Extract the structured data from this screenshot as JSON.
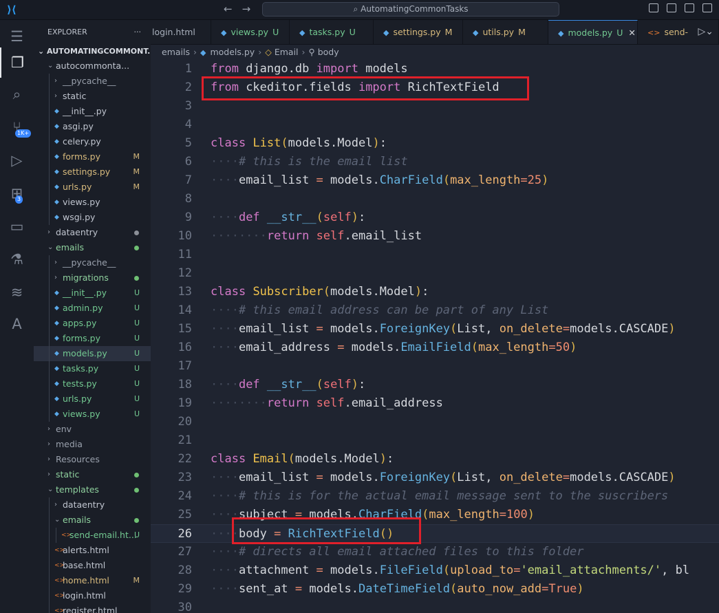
{
  "titlebar": {
    "search_text": "AutomatingCommonTasks"
  },
  "explorer": {
    "header": "EXPLORER",
    "root": "AUTOMATINGCOMMONT...",
    "items": [
      {
        "label": "autocommonta...",
        "depth": 1,
        "kind": "folder",
        "open": true,
        "status": "",
        "statusColor": "#8b8f97"
      },
      {
        "label": "__pycache__",
        "depth": 2,
        "kind": "folder",
        "open": false,
        "status": "",
        "statusColor": "",
        "color": "#9aa1ad"
      },
      {
        "label": "static",
        "depth": 2,
        "kind": "folder",
        "open": false,
        "status": "",
        "statusColor": ""
      },
      {
        "label": "__init__.py",
        "depth": 2,
        "kind": "file",
        "status": "",
        "statusColor": ""
      },
      {
        "label": "asgi.py",
        "depth": 2,
        "kind": "file",
        "status": "",
        "statusColor": ""
      },
      {
        "label": "celery.py",
        "depth": 2,
        "kind": "file",
        "status": "",
        "statusColor": ""
      },
      {
        "label": "forms.py",
        "depth": 2,
        "kind": "file",
        "status": "M",
        "statusColor": "#d7ba7d",
        "color": "#d7ba7d"
      },
      {
        "label": "settings.py",
        "depth": 2,
        "kind": "file",
        "status": "M",
        "statusColor": "#d7ba7d",
        "color": "#d7ba7d"
      },
      {
        "label": "urls.py",
        "depth": 2,
        "kind": "file",
        "status": "M",
        "statusColor": "#d7ba7d",
        "color": "#d7ba7d"
      },
      {
        "label": "views.py",
        "depth": 2,
        "kind": "file",
        "status": "",
        "statusColor": ""
      },
      {
        "label": "wsgi.py",
        "depth": 2,
        "kind": "file",
        "status": "",
        "statusColor": ""
      },
      {
        "label": "dataentry",
        "depth": 1,
        "kind": "folder",
        "open": false,
        "status": "dot",
        "statusColor": "#8b8f97"
      },
      {
        "label": "emails",
        "depth": 1,
        "kind": "folder",
        "open": true,
        "status": "dot",
        "statusColor": "#6fbf73",
        "color": "#8fd19e"
      },
      {
        "label": "__pycache__",
        "depth": 2,
        "kind": "folder",
        "open": false,
        "status": "",
        "statusColor": "",
        "color": "#9aa1ad"
      },
      {
        "label": "migrations",
        "depth": 2,
        "kind": "folder",
        "open": false,
        "status": "dot",
        "statusColor": "#6fbf73",
        "color": "#8fd19e"
      },
      {
        "label": "__init__.py",
        "depth": 2,
        "kind": "file",
        "status": "U",
        "statusColor": "#73c991",
        "color": "#73c991"
      },
      {
        "label": "admin.py",
        "depth": 2,
        "kind": "file",
        "status": "U",
        "statusColor": "#73c991",
        "color": "#73c991"
      },
      {
        "label": "apps.py",
        "depth": 2,
        "kind": "file",
        "status": "U",
        "statusColor": "#73c991",
        "color": "#73c991"
      },
      {
        "label": "forms.py",
        "depth": 2,
        "kind": "file",
        "status": "U",
        "statusColor": "#73c991",
        "color": "#73c991"
      },
      {
        "label": "models.py",
        "depth": 2,
        "kind": "file",
        "status": "U",
        "statusColor": "#73c991",
        "color": "#73c991",
        "selected": true
      },
      {
        "label": "tasks.py",
        "depth": 2,
        "kind": "file",
        "status": "U",
        "statusColor": "#73c991",
        "color": "#73c991"
      },
      {
        "label": "tests.py",
        "depth": 2,
        "kind": "file",
        "status": "U",
        "statusColor": "#73c991",
        "color": "#73c991"
      },
      {
        "label": "urls.py",
        "depth": 2,
        "kind": "file",
        "status": "U",
        "statusColor": "#73c991",
        "color": "#73c991"
      },
      {
        "label": "views.py",
        "depth": 2,
        "kind": "file",
        "status": "U",
        "statusColor": "#73c991",
        "color": "#73c991"
      },
      {
        "label": "env",
        "depth": 1,
        "kind": "folder",
        "open": false,
        "status": "",
        "statusColor": "",
        "color": "#9aa1ad"
      },
      {
        "label": "media",
        "depth": 1,
        "kind": "folder",
        "open": false,
        "status": "",
        "statusColor": "",
        "color": "#9aa1ad"
      },
      {
        "label": "Resources",
        "depth": 1,
        "kind": "folder",
        "open": false,
        "status": "",
        "statusColor": "",
        "color": "#9aa1ad"
      },
      {
        "label": "static",
        "depth": 1,
        "kind": "folder",
        "open": false,
        "status": "dot",
        "statusColor": "#6fbf73",
        "color": "#8fd19e"
      },
      {
        "label": "templates",
        "depth": 1,
        "kind": "folder",
        "open": true,
        "status": "dot",
        "statusColor": "#6fbf73",
        "color": "#8fd19e"
      },
      {
        "label": "dataentry",
        "depth": 2,
        "kind": "folder",
        "open": false,
        "status": "",
        "statusColor": ""
      },
      {
        "label": "emails",
        "depth": 2,
        "kind": "folder",
        "open": true,
        "status": "dot",
        "statusColor": "#6fbf73",
        "color": "#8fd19e"
      },
      {
        "label": "send-email.ht...",
        "depth": 3,
        "kind": "html",
        "status": "U",
        "statusColor": "#73c991",
        "color": "#73c991"
      },
      {
        "label": "alerts.html",
        "depth": 2,
        "kind": "html",
        "status": "",
        "statusColor": ""
      },
      {
        "label": "base.html",
        "depth": 2,
        "kind": "html",
        "status": "",
        "statusColor": ""
      },
      {
        "label": "home.html",
        "depth": 2,
        "kind": "html",
        "status": "M",
        "statusColor": "#d7ba7d",
        "color": "#d7ba7d"
      },
      {
        "label": "login.html",
        "depth": 2,
        "kind": "html",
        "status": "",
        "statusColor": ""
      },
      {
        "label": "register.html",
        "depth": 2,
        "kind": "html",
        "status": "",
        "statusColor": ""
      }
    ]
  },
  "activity_badges": {
    "source_control": "1K+",
    "extensions": "3"
  },
  "tabs": [
    {
      "label": "login.html",
      "kind": "html",
      "status": "",
      "statusColor": "",
      "color": "#a9b0bc"
    },
    {
      "label": "views.py",
      "kind": "py",
      "status": "U",
      "statusColor": "#73c991",
      "color": "#73c991"
    },
    {
      "label": "tasks.py",
      "kind": "py",
      "status": "U",
      "statusColor": "#73c991",
      "color": "#73c991"
    },
    {
      "label": "settings.py",
      "kind": "py",
      "status": "M",
      "statusColor": "#d7ba7d",
      "color": "#d7ba7d"
    },
    {
      "label": "utils.py",
      "kind": "py",
      "status": "M",
      "statusColor": "#d7ba7d",
      "color": "#d7ba7d"
    },
    {
      "label": "models.py",
      "kind": "py",
      "status": "U",
      "statusColor": "#73c991",
      "color": "#73c991",
      "active": true
    },
    {
      "label": "send-",
      "kind": "html",
      "status": "",
      "statusColor": "",
      "color": "#d7ba7d"
    }
  ],
  "breadcrumb": {
    "part1": "emails",
    "part2": "models.py",
    "part3": "Email",
    "part4": "body"
  },
  "editor": {
    "current_line": 26,
    "lines": [
      [
        [
          "kw",
          "from"
        ],
        [
          "id",
          " django.db "
        ],
        [
          "kw",
          "import"
        ],
        [
          "id",
          " models"
        ]
      ],
      [
        [
          "kw",
          "from"
        ],
        [
          "id",
          " ckeditor.fields "
        ],
        [
          "kw",
          "import"
        ],
        [
          "id",
          " RichTextField"
        ]
      ],
      [],
      [],
      [
        [
          "kw",
          "class"
        ],
        [
          "id",
          " "
        ],
        [
          "cls",
          "List"
        ],
        [
          "par",
          "("
        ],
        [
          "id",
          "models.Model"
        ],
        [
          "par",
          ")"
        ],
        [
          "id",
          ":"
        ]
      ],
      [
        [
          "ws",
          "····"
        ],
        [
          "cm",
          "# this is the email list"
        ]
      ],
      [
        [
          "ws",
          "····"
        ],
        [
          "id",
          "email_list "
        ],
        [
          "op",
          "="
        ],
        [
          "id",
          " models."
        ],
        [
          "fn",
          "CharField"
        ],
        [
          "par",
          "("
        ],
        [
          "arg",
          "max_length"
        ],
        [
          "op",
          "="
        ],
        [
          "num",
          "25"
        ],
        [
          "par",
          ")"
        ]
      ],
      [],
      [
        [
          "ws",
          "····"
        ],
        [
          "kw",
          "def"
        ],
        [
          "id",
          " "
        ],
        [
          "fn",
          "__str__"
        ],
        [
          "par",
          "("
        ],
        [
          "slf",
          "self"
        ],
        [
          "par",
          ")"
        ],
        [
          "id",
          ":"
        ]
      ],
      [
        [
          "ws",
          "········"
        ],
        [
          "kw",
          "return"
        ],
        [
          "id",
          " "
        ],
        [
          "slf",
          "self"
        ],
        [
          "id",
          ".email_list"
        ]
      ],
      [],
      [],
      [
        [
          "kw",
          "class"
        ],
        [
          "id",
          " "
        ],
        [
          "cls",
          "Subscriber"
        ],
        [
          "par",
          "("
        ],
        [
          "id",
          "models.Model"
        ],
        [
          "par",
          ")"
        ],
        [
          "id",
          ":"
        ]
      ],
      [
        [
          "ws",
          "····"
        ],
        [
          "cm",
          "# this email address can be part of any List"
        ]
      ],
      [
        [
          "ws",
          "····"
        ],
        [
          "id",
          "email_list "
        ],
        [
          "op",
          "="
        ],
        [
          "id",
          " models."
        ],
        [
          "fn",
          "ForeignKey"
        ],
        [
          "par",
          "("
        ],
        [
          "id",
          "List, "
        ],
        [
          "arg",
          "on_delete"
        ],
        [
          "op",
          "="
        ],
        [
          "id",
          "models.CASCADE"
        ],
        [
          "par",
          ")"
        ]
      ],
      [
        [
          "ws",
          "····"
        ],
        [
          "id",
          "email_address "
        ],
        [
          "op",
          "="
        ],
        [
          "id",
          " models."
        ],
        [
          "fn",
          "EmailField"
        ],
        [
          "par",
          "("
        ],
        [
          "arg",
          "max_length"
        ],
        [
          "op",
          "="
        ],
        [
          "num",
          "50"
        ],
        [
          "par",
          ")"
        ]
      ],
      [],
      [
        [
          "ws",
          "····"
        ],
        [
          "kw",
          "def"
        ],
        [
          "id",
          " "
        ],
        [
          "fn",
          "__str__"
        ],
        [
          "par",
          "("
        ],
        [
          "slf",
          "self"
        ],
        [
          "par",
          ")"
        ],
        [
          "id",
          ":"
        ]
      ],
      [
        [
          "ws",
          "········"
        ],
        [
          "kw",
          "return"
        ],
        [
          "id",
          " "
        ],
        [
          "slf",
          "self"
        ],
        [
          "id",
          ".email_address"
        ]
      ],
      [],
      [],
      [
        [
          "kw",
          "class"
        ],
        [
          "id",
          " "
        ],
        [
          "cls",
          "Email"
        ],
        [
          "par",
          "("
        ],
        [
          "id",
          "models.Model"
        ],
        [
          "par",
          ")"
        ],
        [
          "id",
          ":"
        ]
      ],
      [
        [
          "ws",
          "····"
        ],
        [
          "id",
          "email_list "
        ],
        [
          "op",
          "="
        ],
        [
          "id",
          " models."
        ],
        [
          "fn",
          "ForeignKey"
        ],
        [
          "par",
          "("
        ],
        [
          "id",
          "List, "
        ],
        [
          "arg",
          "on_delete"
        ],
        [
          "op",
          "="
        ],
        [
          "id",
          "models.CASCADE"
        ],
        [
          "par",
          ")"
        ]
      ],
      [
        [
          "ws",
          "····"
        ],
        [
          "cm",
          "# this is for the actual email message sent to the suscribers"
        ]
      ],
      [
        [
          "ws",
          "····"
        ],
        [
          "id",
          "subject "
        ],
        [
          "op",
          "="
        ],
        [
          "id",
          " models."
        ],
        [
          "fn",
          "CharField"
        ],
        [
          "par",
          "("
        ],
        [
          "arg",
          "max_length"
        ],
        [
          "op",
          "="
        ],
        [
          "num",
          "100"
        ],
        [
          "par",
          ")"
        ]
      ],
      [
        [
          "ws",
          "····"
        ],
        [
          "id",
          "body "
        ],
        [
          "op",
          "="
        ],
        [
          "id",
          " "
        ],
        [
          "fn",
          "RichTextField"
        ],
        [
          "par",
          "()"
        ]
      ],
      [
        [
          "ws",
          "····"
        ],
        [
          "cm",
          "# directs all email attached files to this folder"
        ]
      ],
      [
        [
          "ws",
          "····"
        ],
        [
          "id",
          "attachment "
        ],
        [
          "op",
          "="
        ],
        [
          "id",
          " models."
        ],
        [
          "fn",
          "FileField"
        ],
        [
          "par",
          "("
        ],
        [
          "arg",
          "upload_to"
        ],
        [
          "op",
          "="
        ],
        [
          "str",
          "'email_attachments/'"
        ],
        [
          "id",
          ", bl"
        ]
      ],
      [
        [
          "ws",
          "····"
        ],
        [
          "id",
          "sent_at "
        ],
        [
          "op",
          "="
        ],
        [
          "id",
          " models."
        ],
        [
          "fn",
          "DateTimeField"
        ],
        [
          "par",
          "("
        ],
        [
          "arg",
          "auto_now_add"
        ],
        [
          "op",
          "="
        ],
        [
          "num",
          "True"
        ],
        [
          "par",
          ")"
        ]
      ],
      []
    ]
  }
}
